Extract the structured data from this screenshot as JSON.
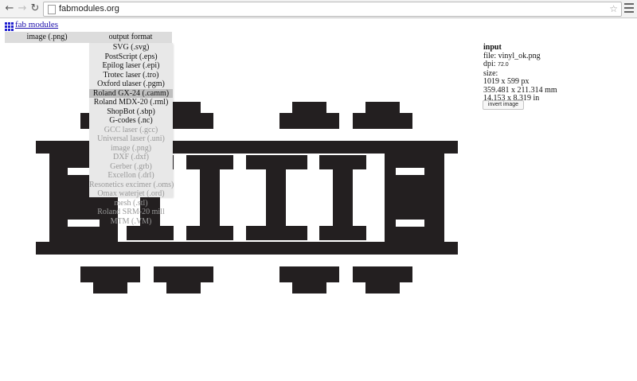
{
  "browser": {
    "back_icon": "back-arrow-icon",
    "forward_icon": "forward-arrow-icon",
    "reload_icon": "reload-icon",
    "url": "fabmodules.org",
    "star_icon": "star-icon",
    "menu_icon": "hamburger-menu-icon"
  },
  "app": {
    "title": "fab modules",
    "input_format": "image (.png)",
    "output_format": "output format"
  },
  "dropdown": {
    "items": [
      {
        "label": "SVG (.svg)",
        "state": "enabled"
      },
      {
        "label": "PostScript (.eps)",
        "state": "enabled"
      },
      {
        "label": "Epilog laser (.epi)",
        "state": "enabled"
      },
      {
        "label": "Trotec laser (.tro)",
        "state": "enabled"
      },
      {
        "label": "Oxford ulaser (.pgm)",
        "state": "enabled"
      },
      {
        "label": "Roland GX-24 (.camm)",
        "state": "highlighted"
      },
      {
        "label": "Roland MDX-20 (.rml)",
        "state": "enabled"
      },
      {
        "label": "ShopBot (.sbp)",
        "state": "enabled"
      },
      {
        "label": "G-codes (.nc)",
        "state": "enabled"
      },
      {
        "label": "GCC laser (.gcc)",
        "state": "disabled"
      },
      {
        "label": "Universal laser (.uni)",
        "state": "disabled"
      },
      {
        "label": "image (.png)",
        "state": "disabled"
      },
      {
        "label": "DXF (.dxf)",
        "state": "disabled"
      },
      {
        "label": "Gerber (.grb)",
        "state": "disabled"
      },
      {
        "label": "Excellon (.drl)",
        "state": "disabled"
      },
      {
        "label": "Resonetics excimer (.oms)",
        "state": "disabled"
      },
      {
        "label": "Omax waterjet (.ord)",
        "state": "disabled"
      },
      {
        "label": "mesh (.stl)",
        "state": "disabled"
      },
      {
        "label": "Roland SRM-20 mill",
        "state": "disabled"
      },
      {
        "label": "MTM (.VM)",
        "state": "disabled"
      }
    ]
  },
  "info": {
    "heading": "input",
    "file_label": "file:",
    "file": "vinyl_ok.png",
    "dpi_label": "dpi:",
    "dpi": "72.0",
    "size_label": "size:",
    "size_px": "1019 x 599 px",
    "size_mm": "359.481 x 211.314 mm",
    "size_in": "14.153 x 8.319 in",
    "invert_button": "invert image"
  },
  "colors": {
    "image_fill": "#231f20",
    "link": "#1a0dab",
    "highlight": "#bfbfbf"
  }
}
